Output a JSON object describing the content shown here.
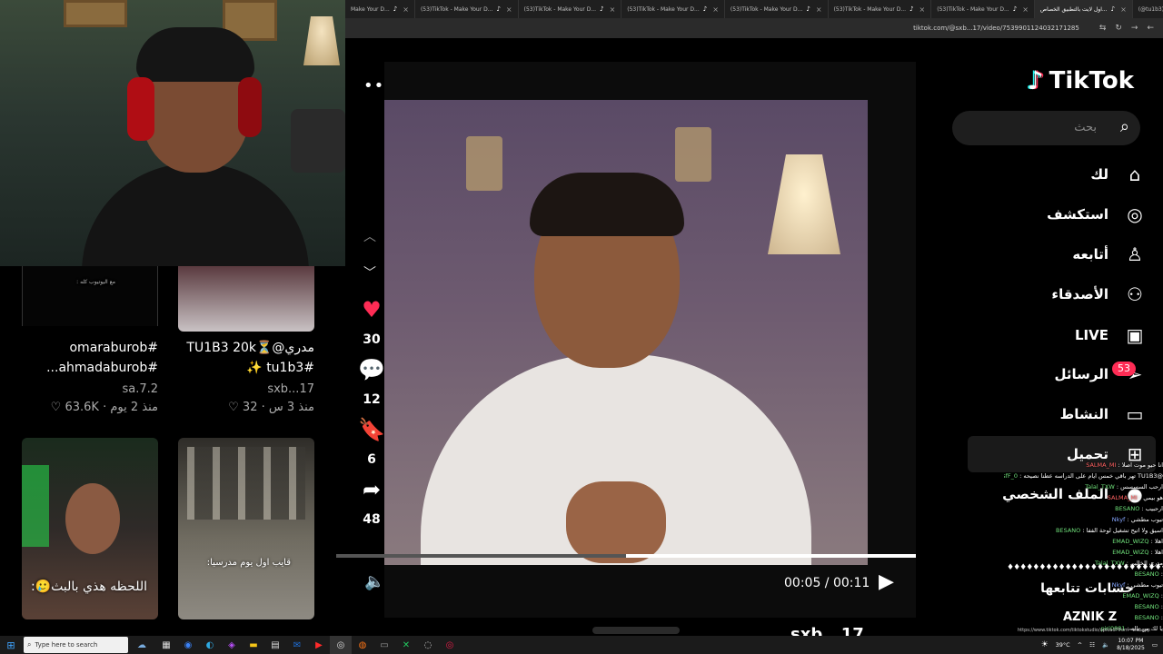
{
  "browser": {
    "tabs": [
      {
        "label": "Make Your D...",
        "icon": "♪"
      },
      {
        "label": "(53)TikTok - Make Your D...",
        "icon": "♪"
      },
      {
        "label": "(53)TikTok - Make Your D...",
        "icon": "♪"
      },
      {
        "label": "(53)TikTok - Make Your D...",
        "icon": "♪"
      },
      {
        "label": "(53)TikTok - Make Your D...",
        "icon": "♪"
      },
      {
        "label": "(53)TikTok - Make Your D...",
        "icon": "♪"
      },
      {
        "label": "(53)TikTok - Make Your D...",
        "icon": "♪"
      },
      {
        "label": "اول لايت بالتطبيق الخصاص...",
        "icon": "♪"
      },
      {
        "label": "(@tu1b3) | TikTok(53) ✨",
        "icon": "♪"
      }
    ],
    "url": "tiktok.com/@sxb...17/video/7539901124032171285"
  },
  "profile_grid": {
    "items": [
      {
        "caption_line1": "#omaraburob",
        "caption_line2": "#ahmadaburob...",
        "handle": "sa.7.2",
        "meta": "منذ 2 يوم · 63.6K ♡"
      },
      {
        "caption_line1": "مدري@⏳TU1B3 20k",
        "caption_line2": "#tu1b3 ✨",
        "handle": "sxb...17",
        "meta": "منذ 3 س · 32 ♡"
      }
    ],
    "thumb_texts": [
      "اللحظه هذي بالبث🥲:",
      "قايب اول يوم مدرسيا:"
    ],
    "tiny_thumb_text": "مع اليوتيوب كله :"
  },
  "video": {
    "likes": "30",
    "comments": "12",
    "saves": "6",
    "shares": "48",
    "time": "00:05 / 00:11",
    "progress": 0.5,
    "author_partial": "sxb...17"
  },
  "sidebar": {
    "logo": "TikTok",
    "search_placeholder": "بحث",
    "nav": [
      {
        "label": "لك",
        "icon": "⌂",
        "name": "foryou"
      },
      {
        "label": "استكشف",
        "icon": "◎",
        "name": "explore"
      },
      {
        "label": "أتابعه",
        "icon": "♙",
        "name": "following"
      },
      {
        "label": "الأصدقاء",
        "icon": "⚇",
        "name": "friends"
      },
      {
        "label": "LIVE",
        "icon": "▣",
        "name": "live"
      },
      {
        "label": "الرسائل",
        "icon": "➢",
        "name": "messages"
      },
      {
        "label": "النشاط",
        "icon": "▭",
        "name": "activity"
      },
      {
        "label": "تحميل",
        "icon": "⊞",
        "name": "upload"
      },
      {
        "label": "الملف الشخصي",
        "icon": "●",
        "name": "profile"
      }
    ],
    "messages_badge": "53",
    "following_accounts_title": "حسابات تتابعها"
  },
  "chat": {
    "lines": [
      {
        "user": "SALMA_MI",
        "text": "انا حيو موت اصلا",
        "color": "red"
      },
      {
        "user": "ssfF_0",
        "text": "@TU1B3 تهر باقي خمس ايام على الدراسه عطنا نصيحه",
        "color": "green"
      },
      {
        "user": "Talal_TXW",
        "text": "ارحب السسسس",
        "color": "green"
      },
      {
        "user": "SALMA_MI",
        "text": "هو بيمي",
        "color": "red"
      },
      {
        "user": "BESANO",
        "text": "ارحبيب",
        "color": "green"
      },
      {
        "user": "Nkyf",
        "text": "تيوب مطشي",
        "color": "blue"
      },
      {
        "user": "BESANO",
        "text": "اسيق ولا اتيح تشغيل لوحة الففا",
        "color": "green"
      },
      {
        "user": "EMAD_WIZQ",
        "text": "اهلا",
        "color": "green"
      },
      {
        "user": "EMAD_WIZQ",
        "text": "اهلا",
        "color": "green"
      },
      {
        "user": "Talal_TXW",
        "text": "مدري الخالين",
        "color": "green"
      },
      {
        "user": "BESANO",
        "text": "",
        "color": "green"
      },
      {
        "user": "Nkyf",
        "text": "تيوب مطشي",
        "color": "blue"
      },
      {
        "user": "EMAD_WIZQ",
        "text": "",
        "color": "green"
      },
      {
        "user": "BESANO",
        "text": "",
        "color": "green"
      },
      {
        "user": "BESANO",
        "text": "",
        "color": "green"
      },
      {
        "user": "piri0881",
        "text": "يا لك من ياله",
        "color": "green"
      }
    ],
    "dashes": "♦♦♦♦♦♦♦♦♦♦♦♦♦♦♦♦♦♦♦♦♦♦♦♦♦♦♦♦♦♦♦♦♦",
    "overlay_name": "AZNIK Z",
    "overlay_url": "https://www.tiktok.com/tiktokstudio/upload?from=webapp"
  },
  "taskbar": {
    "search_placeholder": "Type here to search",
    "weather": "39°C",
    "clock_time": "10:07 PM",
    "clock_date": "8/18/2025"
  }
}
